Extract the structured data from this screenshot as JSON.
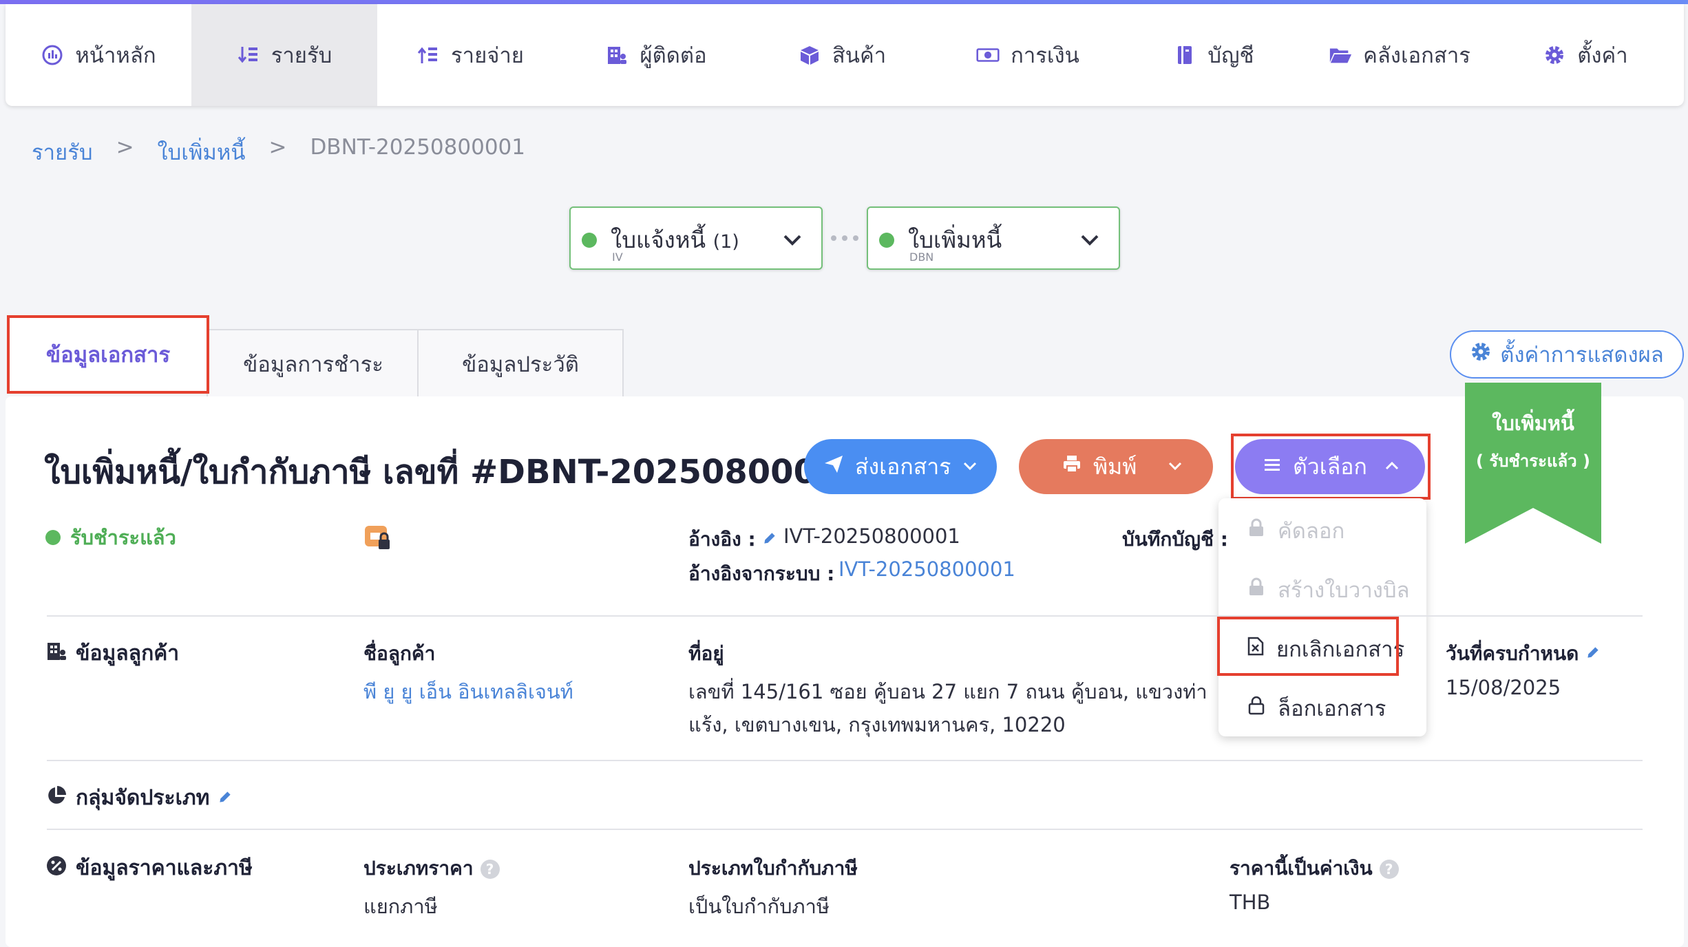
{
  "nav": {
    "items": [
      {
        "label": "หน้าหลัก",
        "icon": "dashboard-gauge-icon"
      },
      {
        "label": "รายรับ",
        "icon": "income-sort-icon"
      },
      {
        "label": "รายจ่าย",
        "icon": "expense-sort-icon"
      },
      {
        "label": "ผู้ติดต่อ",
        "icon": "building-contacts-icon"
      },
      {
        "label": "สินค้า",
        "icon": "box-icon"
      },
      {
        "label": "การเงิน",
        "icon": "money-bill-icon"
      },
      {
        "label": "บัญชี",
        "icon": "ledger-book-icon"
      },
      {
        "label": "คลังเอกสาร",
        "icon": "folder-open-icon"
      },
      {
        "label": "ตั้งค่า",
        "icon": "gear-icon"
      }
    ],
    "active_index": 1
  },
  "breadcrumb": {
    "root": "รายรับ",
    "section": "ใบเพิ่มหนี้",
    "current": "DBNT-20250800001",
    "separator": ">"
  },
  "flow": [
    {
      "title": "ใบแจ้งหนี้",
      "count": "(1)",
      "code": "IV"
    },
    {
      "title": "ใบเพิ่มหนี้",
      "count": "",
      "code": "DBN"
    }
  ],
  "tabs": [
    "ข้อมูลเอกสาร",
    "ข้อมูลการชำระ",
    "ข้อมูลประวัติ"
  ],
  "display_settings_label": "ตั้งค่าการแสดงผล",
  "ribbon": {
    "line1": "ใบเพิ่มหนี้",
    "line2": "( รับชำระแล้ว )",
    "color": "#5cb85f"
  },
  "document": {
    "title": "ใบเพิ่มหนี้/ใบกำกับภาษี เลขที่ #DBNT-20250800001",
    "status": "รับชำระแล้ว"
  },
  "actions": {
    "send": "ส่งเอกสาร",
    "print": "พิมพ์",
    "options": "ตัวเลือก"
  },
  "options_menu": [
    {
      "label": "คัดลอก",
      "disabled": true
    },
    {
      "label": "สร้างใบวางบิล",
      "disabled": true
    },
    {
      "label": "ยกเลิกเอกสาร",
      "disabled": false
    },
    {
      "label": "ล็อกเอกสาร",
      "disabled": false
    }
  ],
  "reference": {
    "label": "อ้างอิง :",
    "value": "IVT-20250800001",
    "system_label": "อ้างอิงจากระบบ :",
    "system_value": "IVT-20250800001",
    "account_label": "บันทึกบัญชี :"
  },
  "customer": {
    "section": "ข้อมูลลูกค้า",
    "name_label": "ชื่อลูกค้า",
    "name": "พี ยู ยู เอ็น อินเทลลิเจนท์",
    "address_label": "ที่อยู่",
    "address_line1": "เลขที่ 145/161 ซอย คู้บอน 27 แยก 7 ถนน คู้บอน, แขวงท่า",
    "address_line2": "แร้ง, เขตบางเขน, กรุงเทพมหานคร, 10220",
    "due_label": "วันที่ครบกำหนด",
    "due_date": "15/08/2025"
  },
  "category": {
    "section": "กลุ่มจัดประเภท"
  },
  "pricing": {
    "section": "ข้อมูลราคาและภาษี",
    "price_type_label": "ประเภทราคา",
    "price_type": "แยกภาษี",
    "tax_doc_label": "ประเภทใบกำกับภาษี",
    "tax_doc": "เป็นใบกำกับภาษี",
    "currency_label": "ราคานี้เป็นค่าเงิน",
    "currency": "THB"
  },
  "colors": {
    "accent": "#6b5bd8",
    "link": "#4a84d7",
    "send": "#4a8ef2",
    "print": "#e57a5e",
    "options": "#8c7cf2",
    "highlight": "#e5402f"
  }
}
